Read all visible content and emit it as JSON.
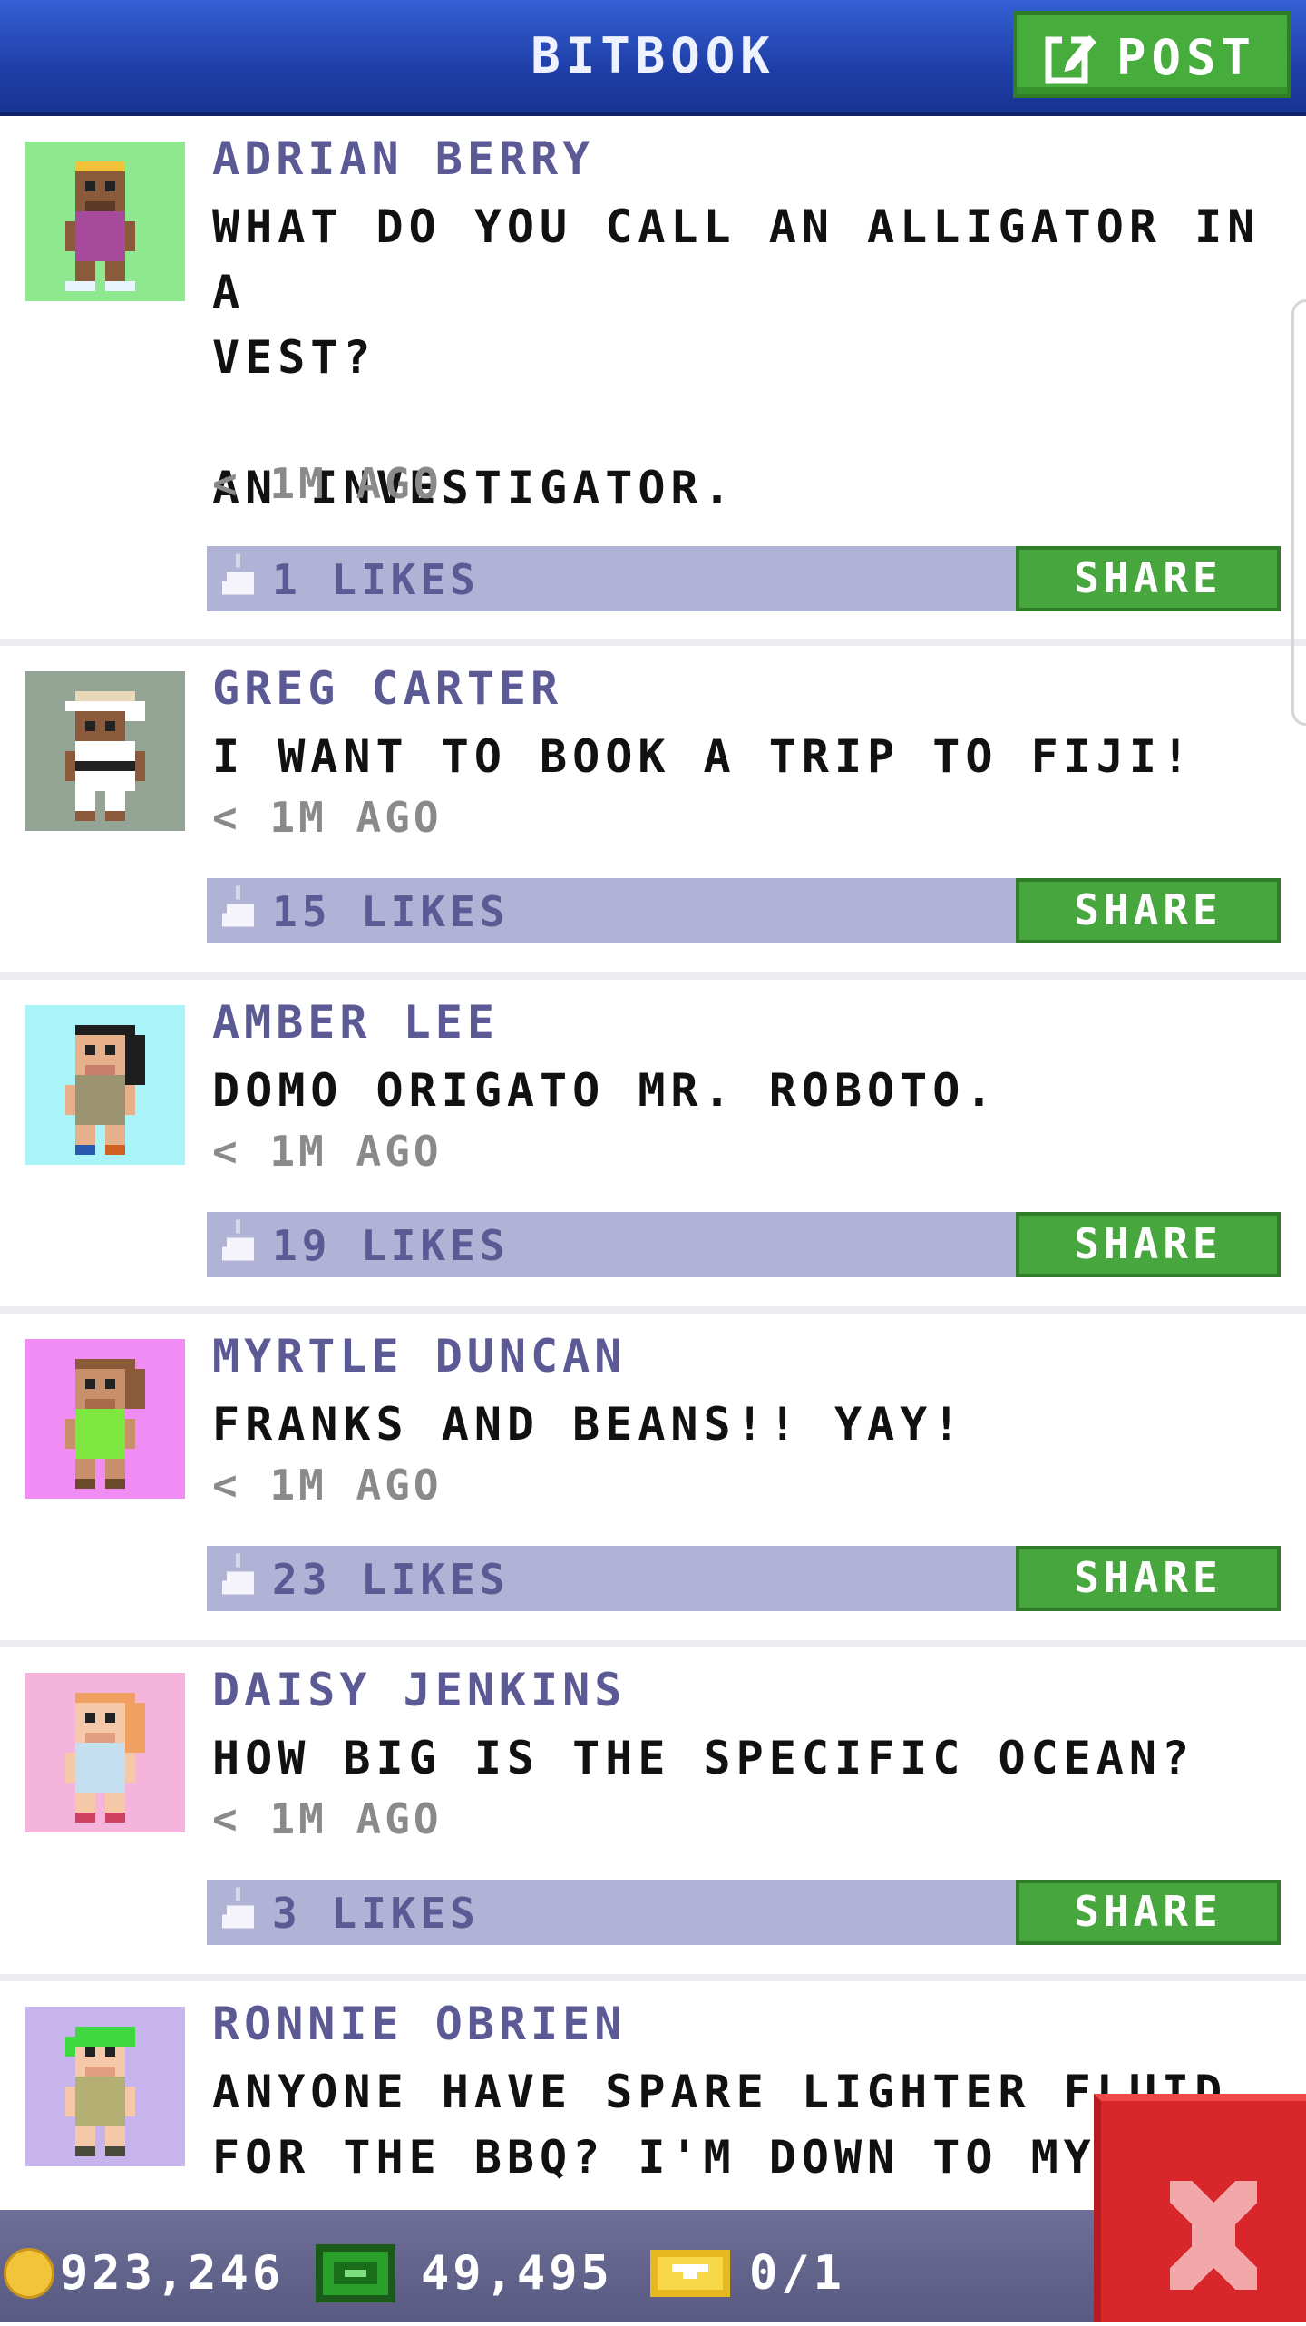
{
  "header": {
    "title": "BITBOOK",
    "post_label": "POST"
  },
  "posts": [
    {
      "author": "ADRIAN BERRY",
      "message": "WHAT DO YOU CALL AN ALLIGATOR IN A\nVEST?\n\nAN INVESTIGATOR.",
      "time": "< 1M AGO",
      "likes": "1 LIKES",
      "share": "SHARE",
      "avatar_bg": "#8ee88e"
    },
    {
      "author": "GREG CARTER",
      "message": "I WANT TO BOOK A TRIP TO FIJI!",
      "time": "< 1M AGO",
      "likes": "15 LIKES",
      "share": "SHARE",
      "avatar_bg": "#94a494"
    },
    {
      "author": "AMBER LEE",
      "message": "DOMO ORIGATO MR. ROBOTO.",
      "time": "< 1M AGO",
      "likes": "19 LIKES",
      "share": "SHARE",
      "avatar_bg": "#a8f4f8"
    },
    {
      "author": "MYRTLE DUNCAN",
      "message": "FRANKS AND BEANS!! YAY!",
      "time": "< 1M AGO",
      "likes": "23 LIKES",
      "share": "SHARE",
      "avatar_bg": "#f08cf4"
    },
    {
      "author": "DAISY JENKINS",
      "message": "HOW BIG IS THE SPECIFIC OCEAN?",
      "time": "< 1M AGO",
      "likes": "3 LIKES",
      "share": "SHARE",
      "avatar_bg": "#f4b4dc"
    },
    {
      "author": "RONNIE OBRIEN",
      "message": "ANYONE HAVE SPARE LIGHTER FLUID\nFOR THE BBQ? I'M DOWN TO MY",
      "avatar_bg": "#c8b4ec"
    }
  ],
  "status": {
    "coins": "923,246",
    "bux": "49,495",
    "tickets": "0/1"
  },
  "colors": {
    "header": "#2a4fc4",
    "accent_green": "#46ad3d",
    "likes_bar": "#b1b3d6",
    "author_text": "#5c5a94",
    "close_red": "#d9262a"
  },
  "icons": [
    "post-edit-icon",
    "like-icon",
    "coin-icon",
    "bux-icon",
    "ticket-icon",
    "close-icon"
  ]
}
